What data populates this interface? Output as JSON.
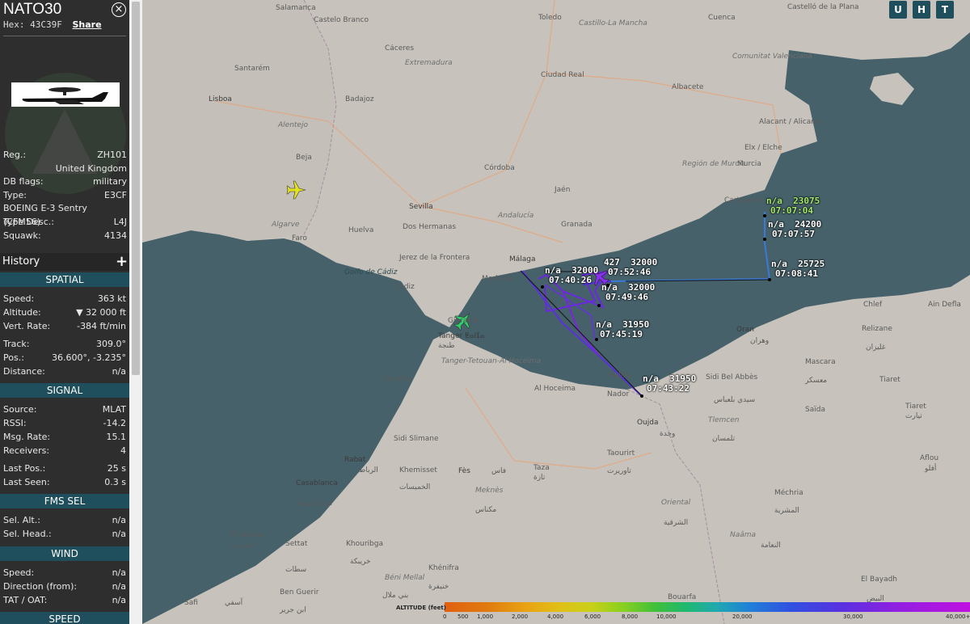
{
  "sidebar": {
    "callsign": "NATO30",
    "hex_label": "Hex:",
    "hex": "43C39F",
    "share": "Share",
    "close_icon": "close-circle-icon",
    "info": [
      {
        "label": "Reg.:",
        "value": "ZH101"
      },
      {
        "label": "",
        "value": "United Kingdom"
      },
      {
        "label": "DB flags:",
        "value": "military"
      },
      {
        "label": "Type:",
        "value": "E3CF"
      },
      {
        "label": "BOEING E-3 Sentry (CFM56)",
        "value": ""
      },
      {
        "label": "Type Desc.:",
        "value": "L4J"
      },
      {
        "label": "Squawk:",
        "value": "4134"
      }
    ],
    "history": "History",
    "history_plus": "+",
    "spatial": {
      "title": "SPATIAL",
      "rows": [
        {
          "label": "Speed:",
          "value": "363 kt"
        },
        {
          "label": "Altitude:",
          "value": "▼ 32 000 ft"
        },
        {
          "label": "Vert. Rate:",
          "value": "-384 ft/min"
        },
        {
          "label": "Track:",
          "value": "309.0°"
        },
        {
          "label": "Pos.:",
          "value": "36.600°, -3.235°"
        },
        {
          "label": "Distance:",
          "value": "n/a"
        }
      ]
    },
    "signal": {
      "title": "SIGNAL",
      "rows": [
        {
          "label": "Source:",
          "value": "MLAT"
        },
        {
          "label": "RSSI:",
          "value": "-14.2"
        },
        {
          "label": "Msg. Rate:",
          "value": "15.1"
        },
        {
          "label": "Receivers:",
          "value": "4"
        },
        {
          "label": "Last Pos.:",
          "value": "25 s"
        },
        {
          "label": "Last Seen:",
          "value": "0.3 s"
        }
      ]
    },
    "fms": {
      "title": "FMS SEL",
      "rows": [
        {
          "label": "Sel. Alt.:",
          "value": "n/a"
        },
        {
          "label": "Sel. Head.:",
          "value": "n/a"
        }
      ]
    },
    "wind": {
      "title": "WIND",
      "rows": [
        {
          "label": "Speed:",
          "value": "n/a"
        },
        {
          "label": "Direction (from):",
          "value": "n/a"
        },
        {
          "label": "TAT / OAT:",
          "value": "n/a"
        }
      ]
    },
    "speed_title": "SPEED"
  },
  "map": {
    "buttons": [
      "U",
      "H",
      "T"
    ],
    "track_labels": [
      {
        "alt": "n/a  23075",
        "time": "07:07:04",
        "highlight": true
      },
      {
        "alt": "n/a  24200",
        "time": "07:07:57"
      },
      {
        "alt": "n/a  25725",
        "time": "07:08:41"
      },
      {
        "alt": "427  32000",
        "time": "07:52:46"
      },
      {
        "alt": "n/a  32000",
        "time": "07:40:26"
      },
      {
        "alt": "n/a  32000",
        "time": "07:49:46"
      },
      {
        "alt": "n/a  31950",
        "time": "07:45:19"
      },
      {
        "alt": "n/a  31950",
        "time": "07:43:22"
      }
    ],
    "places": [
      "Salamanca",
      "Toledo",
      "Cuenca",
      "Castelló de la Plana",
      "Castillo-La Mancha",
      "Castelo Branco",
      "Cáceres",
      "Extremadura",
      "Ciudad Real",
      "Comunitat Valenciana",
      "Santarém",
      "Lisboa",
      "Badajoz",
      "Albacete",
      "Alentejo",
      "Alacant / Alicante",
      "Beja",
      "Córdoba",
      "Región de Murcia",
      "Murcia",
      "Elx / Elche",
      "Jaén",
      "Cartagena",
      "Sevilla",
      "Andalucía",
      "Algarve",
      "Faro",
      "Huelva",
      "Dos Hermanas",
      "Granada",
      "Jerez de la Frontera",
      "Golfo de Cádiz",
      "Cádiz",
      "Marbella",
      "Málaga",
      "Gibraltar",
      "Tanger ⵟⴰⵏⵊⴰ",
      "طنجة",
      "Tanger-Tetouan-Al Hoceima",
      "Larache",
      "Al Hoceima",
      "Nador",
      "Melilla",
      "Oujda",
      "وجدة",
      "Sidi Bel Abbès",
      "سيدي بلعباس",
      "Oran",
      "وهران",
      "Mascara",
      "معسكر",
      "Tiaret",
      "Chlef",
      "Ain Defla",
      "Relizane",
      "غليزان",
      "Tlemcen",
      "تلمسان",
      "Saïda",
      "Sidi Slimane",
      "Rabat",
      "الرباط",
      "Khemisset",
      "الخميسات",
      "Fès",
      "فاس",
      "Taza",
      "تازة",
      "Taourirt",
      "تاوريرت",
      "Casablanca",
      "الدار البيضاء",
      "Meknès",
      "مكناس",
      "Oriental",
      "الشرقية",
      "El Jadida",
      "الجديدة",
      "Settat",
      "سطات",
      "Khouribga",
      "خريبكة",
      "Béni Mellal",
      "بني ملال",
      "Khénifra",
      "خنيفرة",
      "Ben Guerir",
      "ابن جرير",
      "Safi",
      "آسفي",
      "Bouarfa",
      "Naâma",
      "النعامة",
      "Méchria",
      "المشرية",
      "El Bayadh",
      "البيض",
      "Aflou",
      "أفلو",
      "Tiaret",
      "تيارت"
    ],
    "altitude_legend": {
      "title": "ALTITUDE (feet)",
      "ticks": [
        "0",
        "500",
        "1,000",
        "2,000",
        "4,000",
        "6,000",
        "8,000",
        "10,000",
        "20,000",
        "30,000",
        "40,000+"
      ]
    }
  }
}
